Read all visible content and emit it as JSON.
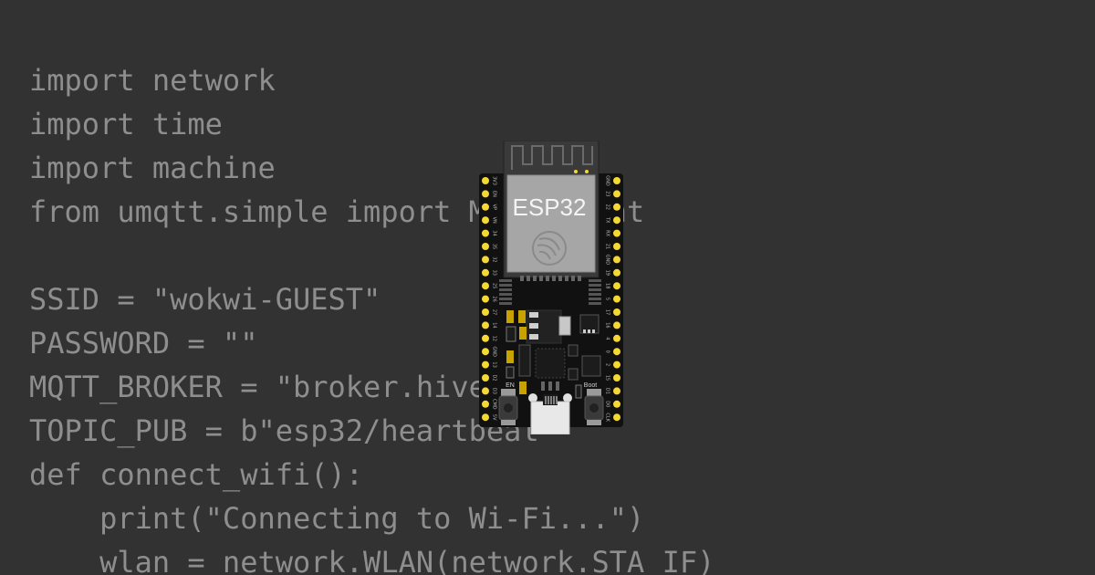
{
  "code": {
    "lines": [
      "import network",
      "import time",
      "import machine",
      "from umqtt.simple import MQTTClient",
      "",
      "SSID = \"wokwi-GUEST\"",
      "PASSWORD = \"\"",
      "MQTT_BROKER = \"broker.hivemq.com\"",
      "TOPIC_PUB = b\"esp32/heartbeat\"",
      "def connect_wifi():",
      "    print(\"Connecting to Wi-Fi...\")",
      "    wlan = network.WLAN(network.STA_IF)"
    ]
  },
  "board": {
    "module_label": "ESP32",
    "en_button_label": "EN",
    "boot_button_label": "Boot",
    "left_pins": [
      "3V3",
      "EN",
      "VP",
      "VN",
      "34",
      "35",
      "32",
      "33",
      "25",
      "26",
      "27",
      "14",
      "12",
      "GND",
      "13",
      "D2",
      "D3",
      "CMD",
      "5V"
    ],
    "right_pins": [
      "GND",
      "23",
      "22",
      "TX",
      "RX",
      "21",
      "GND",
      "19",
      "18",
      "5",
      "17",
      "16",
      "4",
      "0",
      "2",
      "15",
      "D1",
      "D0",
      "CLK"
    ]
  },
  "colors": {
    "background": "#323232",
    "code_text": "#8e8e8e",
    "board": "#111111",
    "pin": "#f5d833",
    "module_shield": "#a6a6a6",
    "antenna": "#5a5a5a"
  }
}
